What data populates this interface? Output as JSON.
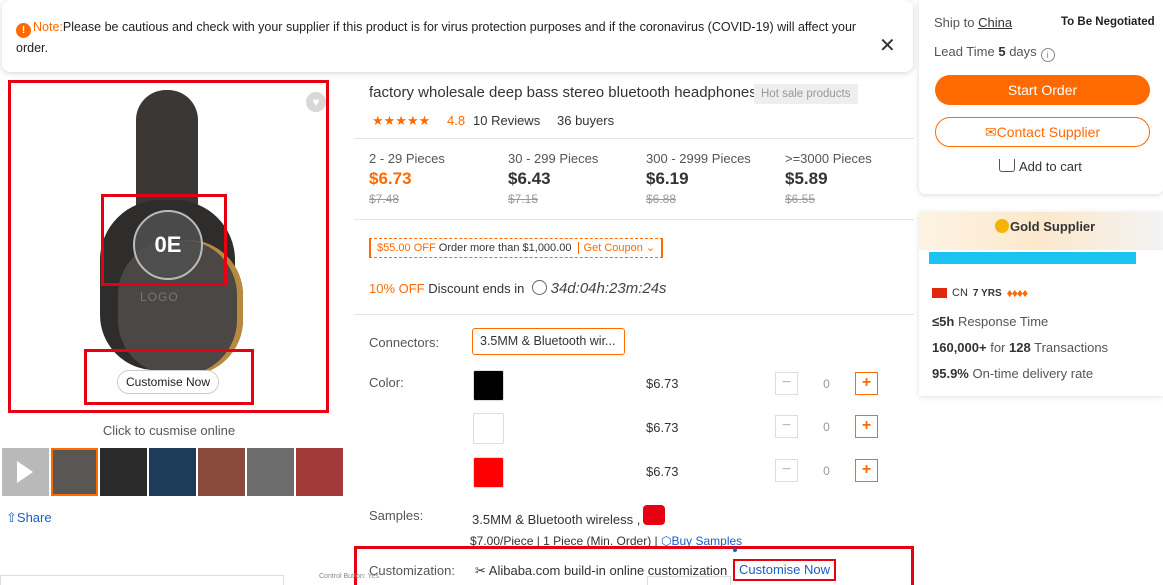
{
  "notice": {
    "label": "Note:",
    "message": "Please be cautious and check with your supplier if this product is for virus protection purposes and if the coronavirus (COVID-19) will affect your order.",
    "close_glyph": "✕"
  },
  "gallery": {
    "logo_text": "LOGO",
    "badge_glyph": "0E",
    "customise_button": "Customise Now",
    "caption": "Click to cusmise online",
    "share": "Share"
  },
  "product": {
    "title": "factory wholesale deep bass stereo bluetooth headphones",
    "tag": "Hot sale products",
    "stars": "★★★★★",
    "rating": "4.8",
    "reviews": "10 Reviews",
    "buyers": "36 buyers"
  },
  "price_tiers": [
    {
      "qty": "2 - 29 Pieces",
      "price": "$6.73",
      "old": "$7.48"
    },
    {
      "qty": "30 - 299 Pieces",
      "price": "$6.43",
      "old": "$7.15"
    },
    {
      "qty": "300 - 2999 Pieces",
      "price": "$6.19",
      "old": "$6.88"
    },
    {
      "qty": ">=3000 Pieces",
      "price": "$5.89",
      "old": "$6.55"
    }
  ],
  "coupon": {
    "amount": "$55.00 OFF",
    "condition": "Order more than $1,000.00",
    "action": "Get Coupon ⌄"
  },
  "discount": {
    "percent": "10% OFF",
    "text": "Discount ends in",
    "countdown": "34d:04h:23m:24s"
  },
  "options": {
    "connectors_label": "Connectors:",
    "connector_value": "3.5MM & Bluetooth wir...",
    "color_label": "Color:",
    "colors": [
      {
        "swatch": "#000000",
        "price": "$6.73",
        "qty": "0"
      },
      {
        "swatch": "#ffffff",
        "price": "$6.73",
        "qty": "0"
      },
      {
        "swatch": "#ff0000",
        "price": "$6.73",
        "qty": "0"
      }
    ],
    "minus": "−",
    "plus": "+"
  },
  "samples": {
    "label": "Samples:",
    "text": "3.5MM & Bluetooth wireless ,",
    "price": "$7.00/Piece | 1 Piece (Min. Order) | ",
    "buy": "Buy Samples"
  },
  "customization": {
    "label": "Customization:",
    "text": "Alibaba.com build-in online customization",
    "link": "Customise Now",
    "tiny_note": "Control Button: Yes"
  },
  "order": {
    "ship_to_label": "Ship to",
    "ship_to_value": "China",
    "shipping_cost": "To Be Negotiated",
    "lead_time_label": "Lead Time",
    "lead_time_value": "5",
    "lead_time_unit": "days",
    "start_order": "Start Order",
    "contact_supplier": "Contact Supplier",
    "add_to_cart": "Add to cart"
  },
  "supplier": {
    "badge": "Gold Supplier",
    "country": "CN",
    "years": "7 YRS",
    "response_value": "≤5h",
    "response_label": "Response Time",
    "transactions_amount": "160,000+",
    "transactions_mid": "for",
    "transactions_count": "128",
    "transactions_label": "Transactions",
    "delivery_rate": "95.9%",
    "delivery_label": "On-time delivery rate"
  },
  "colors": {
    "accent": "#ff6a00",
    "link": "#1a5dc8",
    "highlight": "#e60012"
  }
}
